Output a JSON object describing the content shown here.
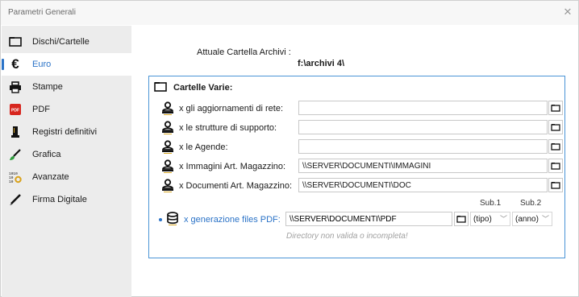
{
  "window": {
    "title": "Parametri Generali",
    "close_glyph": "✕"
  },
  "sidebar": {
    "items": [
      {
        "label": "Dischi/Cartelle",
        "icon": "folder-icon",
        "active": false
      },
      {
        "label": "Euro",
        "icon": "euro-icon",
        "active": true
      },
      {
        "label": "Stampe",
        "icon": "printer-icon",
        "active": false
      },
      {
        "label": "PDF",
        "icon": "pdf-icon",
        "active": false
      },
      {
        "label": "Registri definitivi",
        "icon": "register-icon",
        "active": false
      },
      {
        "label": "Grafica",
        "icon": "brush-icon",
        "active": false
      },
      {
        "label": "Avanzate",
        "icon": "advanced-icon",
        "active": false
      },
      {
        "label": "Firma Digitale",
        "icon": "pen-icon",
        "active": false
      }
    ],
    "accent_color": "#2b73c7"
  },
  "main": {
    "archive_label": "Attuale Cartella Archivi :",
    "archive_value": "f:\\archivi 4\\",
    "group": {
      "title": "Cartelle Varie:",
      "rows": [
        {
          "label": "x gli aggiornamenti di rete:",
          "value": ""
        },
        {
          "label": "x le strutture di supporto:",
          "value": ""
        },
        {
          "label": "x le Agende:",
          "value": ""
        },
        {
          "label": "x Immagini Art. Magazzino:",
          "value": "\\\\SERVER\\DOCUMENTI\\IMMAGINI"
        },
        {
          "label": "x Documenti Art. Magazzino:",
          "value": "\\\\SERVER\\DOCUMENTI\\DOC"
        }
      ],
      "pdf": {
        "label": "x generazione files PDF:",
        "value": "\\\\SERVER\\DOCUMENTI\\PDF",
        "sub1_label": "Sub.1",
        "sub1_value": "(tipo)",
        "sub2_label": "Sub.2",
        "sub2_value": "(anno)",
        "hint": "Directory non valida o incompleta!"
      },
      "border_color": "#4a94d6"
    }
  }
}
